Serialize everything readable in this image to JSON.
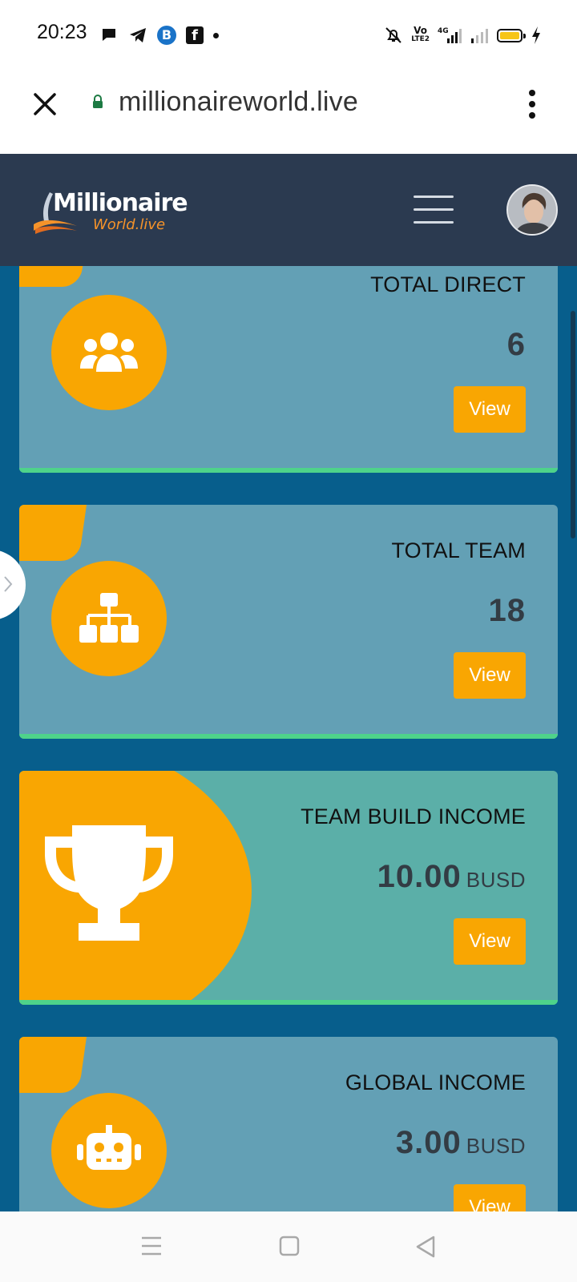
{
  "status_bar": {
    "time": "20:23",
    "left_icons": [
      "chat-bubble-icon",
      "telegram-icon",
      "b-app-icon",
      "facebook-icon",
      "notification-dot-icon"
    ],
    "b_letter": "B",
    "f_letter": "f",
    "network_top": "Vo",
    "network_bottom": "LTE2",
    "network_type": "4G",
    "battery_color": "#f6c518"
  },
  "browser": {
    "url": "millionaireworld.live",
    "secure": true
  },
  "header": {
    "logo_line1": "Millionaire",
    "logo_line2": "World.live",
    "logo_accent": "#f5932a",
    "background": "#2b3a50"
  },
  "cards": [
    {
      "title": "TOTAL DIRECT",
      "value": "6",
      "unit": "",
      "button": "View",
      "icon": "users-group-icon"
    },
    {
      "title": "TOTAL TEAM",
      "value": "18",
      "unit": "",
      "button": "View",
      "icon": "org-chart-icon"
    },
    {
      "title": "TEAM BUILD INCOME",
      "value": "10.00",
      "unit": "BUSD",
      "button": "View",
      "icon": "trophy-icon"
    },
    {
      "title": "GLOBAL INCOME",
      "value": "3.00",
      "unit": "BUSD",
      "button": "View",
      "icon": "robot-icon"
    }
  ],
  "colors": {
    "page_bg": "#075e8c",
    "card_bg": "#63a0b5",
    "card_teal_bg": "#5bafa8",
    "accent_orange": "#f9a602",
    "card_border_green": "#4ed38a"
  },
  "nav_bar": {
    "icons": [
      "menu-lines-icon",
      "home-square-icon",
      "back-triangle-icon"
    ]
  }
}
